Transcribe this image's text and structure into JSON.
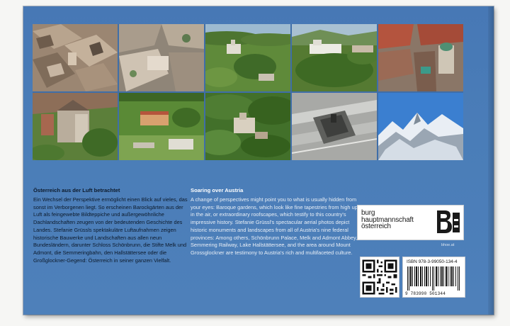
{
  "book": {
    "cover_color": "#4a7cb8",
    "photo_tiles": [
      "aerial-old-town-rooftops",
      "aerial-baroque-city-square",
      "aerial-castle-on-green-hill",
      "aerial-fortress-over-city",
      "aerial-red-roofs-green-dome",
      "aerial-medieval-castle-towers",
      "aerial-palace-with-gardens",
      "aerial-abbey-in-forest",
      "aerial-monument-on-square",
      "aerial-snowy-alps"
    ]
  },
  "german": {
    "heading": "Österreich aus der Luft betrachtet",
    "body": "Ein Wechsel der Perspektive ermöglicht einen Blick auf vieles, das sonst im Verborgenen liegt. So erscheinen Barockgärten aus der Luft als feingewebte Bildteppiche und außergewöhnliche Dachlandschaften zeugen von der bedeutenden Geschichte des Landes. Stefanie Grüssls spektakuläre Luftaufnahmen zeigen historische Bauwerke und Landschaften aus allen neun Bundesländern, darunter Schloss Schönbrunn, die Stifte Melk und Admont, die Semmeringbahn, den Hallstättersee oder die Großglockner-Gegend: Österreich in seiner ganzen Vielfalt."
  },
  "english": {
    "heading": "Soaring over Austria",
    "body": "A change of perspectives might point you to what is usually hidden from your eyes: Baroque gardens, which look like fine tapestries from high up in the air, or extraordinary roofscapes, which testify to this country's impressive history. Stefanie Grüssl's spectacular aerial photos depict historic monuments and landscapes from all of Austria's nine federal provinces: Among others, Schönbrunn Palace, Melk and Admont Abbey, Semmering Railway, Lake Hallstättersee, and the area around Mount Grossglockner are testimony to Austria's rich and multifaceted culture."
  },
  "publisher": {
    "logo_line1": "burg",
    "logo_line2": "hauptmannschaft",
    "logo_line3": "österreich",
    "logo_mark": "BHÖ",
    "website": "bhoe.at"
  },
  "isbn": {
    "label": "ISBN 978-3-99050-134-4",
    "barcode_digits": "9 783990 501344"
  }
}
